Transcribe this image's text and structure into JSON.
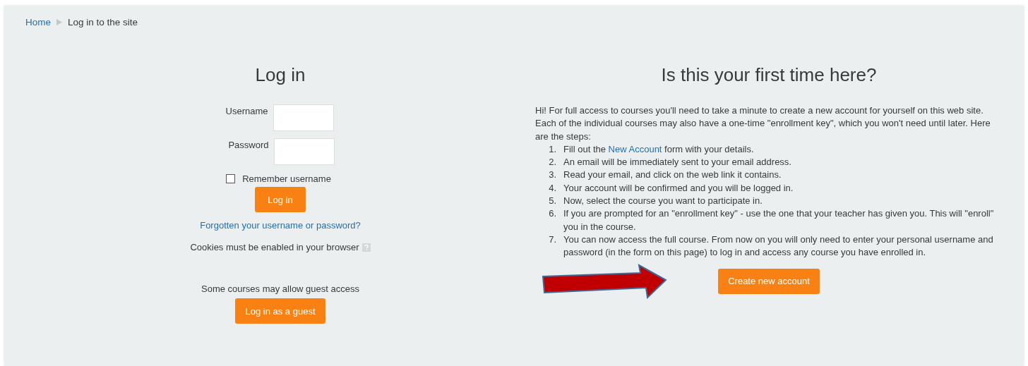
{
  "breadcrumb": [
    {
      "label": "Home",
      "kind": "link"
    },
    {
      "label": "Log in to the site",
      "kind": "current"
    }
  ],
  "login": {
    "title": "Log in",
    "fields": [
      {
        "label": "Username"
      },
      {
        "label": "Password"
      }
    ],
    "remember": {
      "label": "Remember username",
      "checked": false
    },
    "button": "Log in",
    "forgot_link": "Forgotten your username or password?",
    "cookies_note": "Cookies must be enabled in your browser",
    "guest_note": "Some courses may allow guest access",
    "guest_button": "Log in as a guest"
  },
  "signup": {
    "title": "Is this your first time here?",
    "intro": "Hi! For full access to courses you'll need to take a minute to create a new account for yourself on this web site. Each of the individual courses may also have a one-time \"enrollment key\", which you won't need until later. Here are the steps:",
    "steps": [
      {
        "number": "1.",
        "parts": [
          {
            "kind": "text",
            "text": "Fill out the "
          },
          {
            "kind": "link",
            "text": "New Account"
          },
          {
            "kind": "text",
            "text": " form with your details."
          }
        ]
      },
      {
        "number": "2.",
        "parts": [
          {
            "kind": "text",
            "text": "An email will be immediately sent to your email address."
          }
        ]
      },
      {
        "number": "3.",
        "parts": [
          {
            "kind": "text",
            "text": "Read your email, and click on the web link it contains."
          }
        ]
      },
      {
        "number": "4.",
        "parts": [
          {
            "kind": "text",
            "text": "Your account will be confirmed and you will be logged in."
          }
        ]
      },
      {
        "number": "5.",
        "parts": [
          {
            "kind": "text",
            "text": "Now, select the course you want to participate in."
          }
        ]
      },
      {
        "number": "6.",
        "parts": [
          {
            "kind": "text",
            "text": "If you are prompted for an \"enrollment key\" - use the one that your teacher has given you. This will \"enroll\" you in the course."
          }
        ]
      },
      {
        "number": "7.",
        "parts": [
          {
            "kind": "text",
            "text": "You can now access the full course. From now on you will only need to enter your personal username and password (in the form on this page) to log in and access any course you have enrolled in."
          }
        ]
      }
    ],
    "button": "Create new account"
  }
}
